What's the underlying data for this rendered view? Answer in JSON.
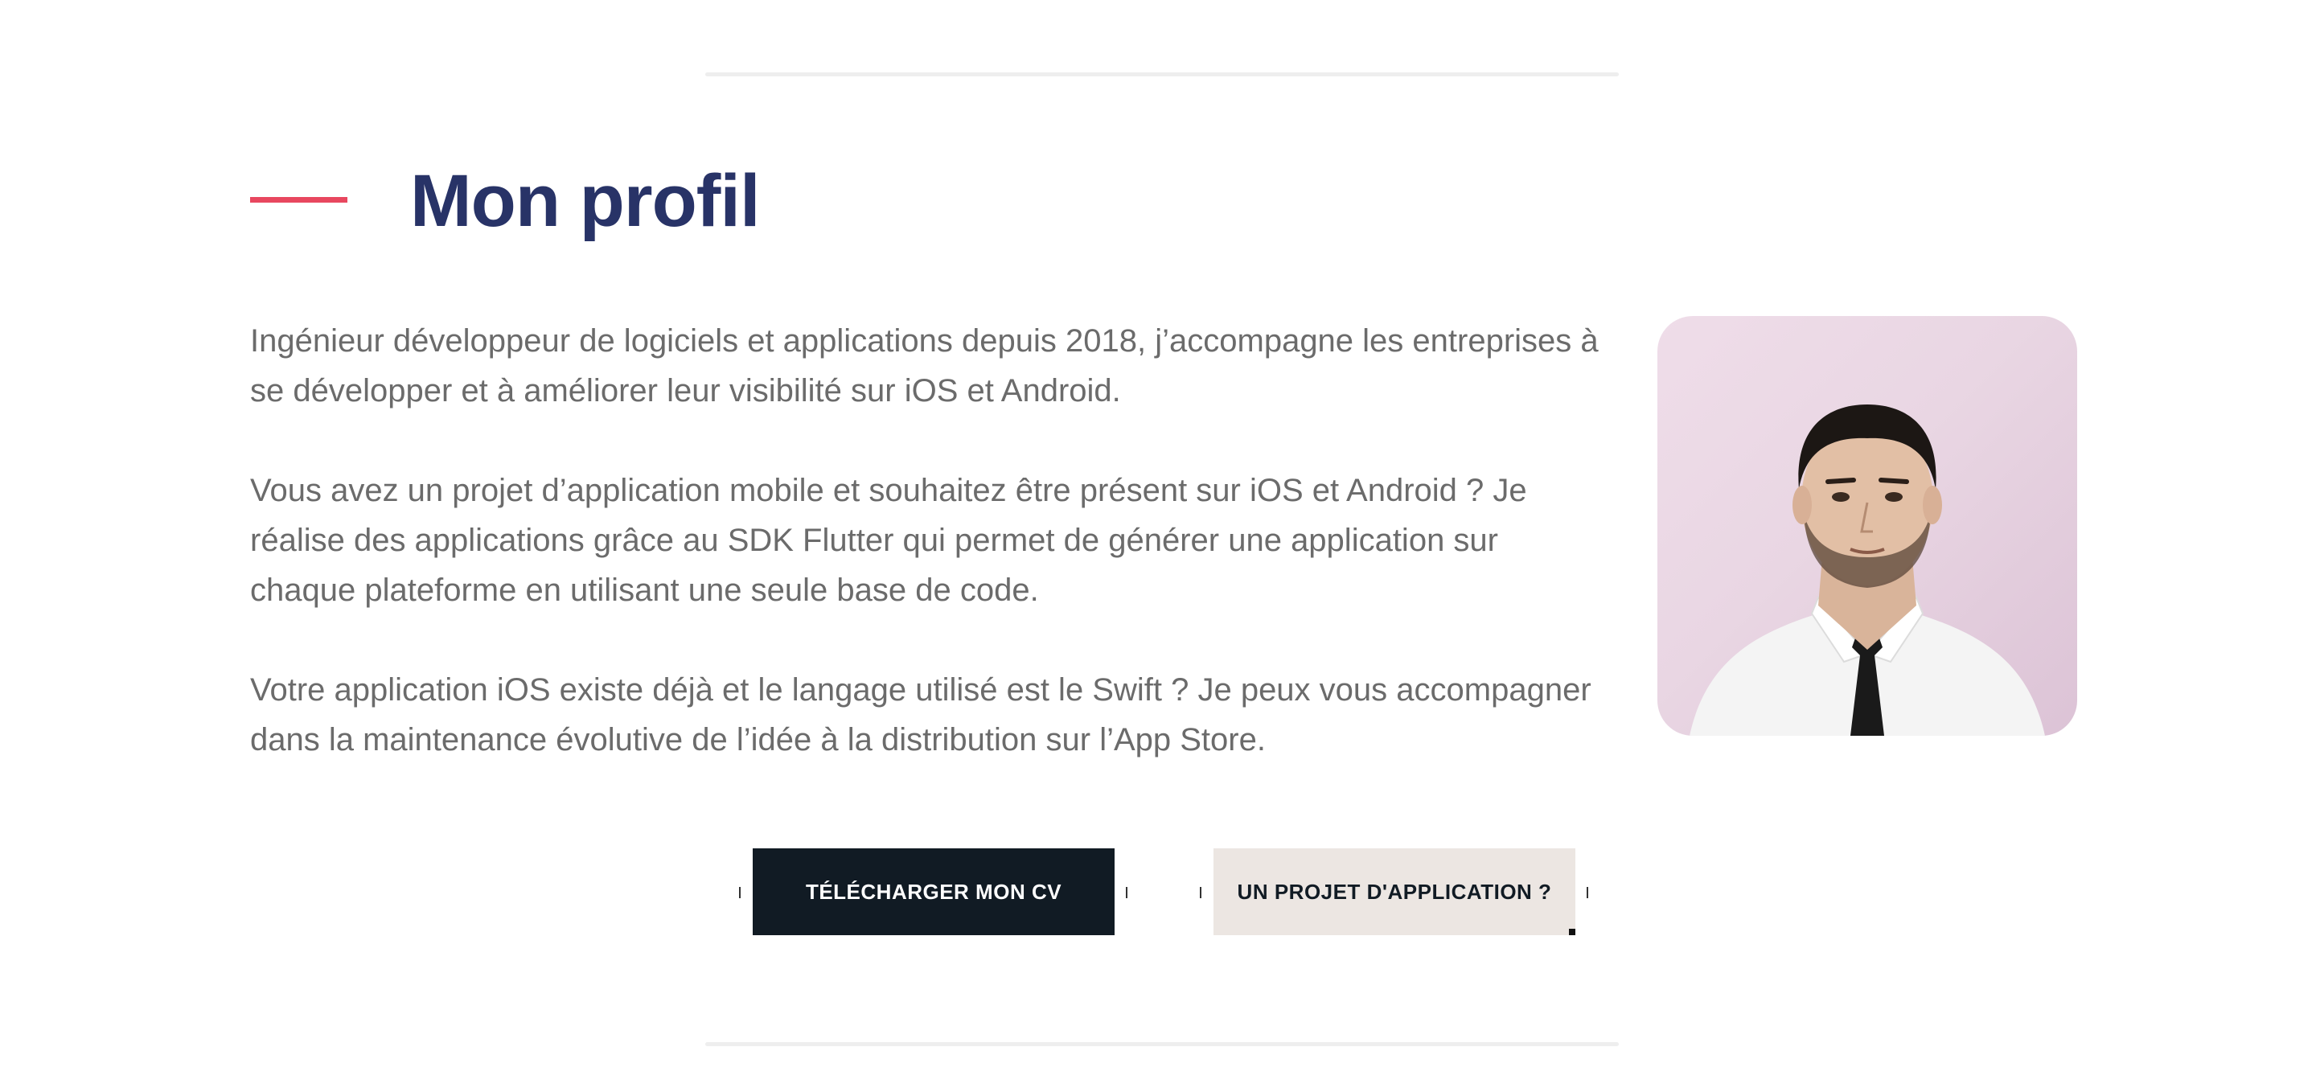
{
  "section": {
    "title": "Mon profil",
    "paragraphs": [
      "Ingénieur développeur de logiciels et applications depuis 2018, j’accompagne les entreprises à se développer et à améliorer leur visibilité sur iOS et Android.",
      "Vous avez un projet d’application mobile et souhaitez être présent sur iOS et Android ? Je réalise des applications grâce au SDK Flutter qui permet de générer une application sur chaque plateforme en utilisant une seule base de code.",
      "Votre application iOS existe déjà et le langage utilisé est le Swift ? Je peux vous accompagner dans la maintenance évolutive de l’idée à la distribution sur l’App Store."
    ]
  },
  "buttons": {
    "download_cv": "TÉLÉCHARGER MON CV",
    "project": "UN PROJET D'APPLICATION ?"
  },
  "colors": {
    "accent": "#e8475f",
    "title": "#283367",
    "text": "#6b6b6b",
    "dark_button": "#111b24",
    "light_button": "#ece6e2"
  }
}
